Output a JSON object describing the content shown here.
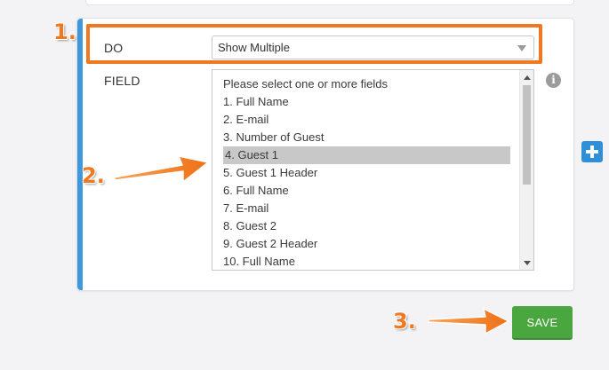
{
  "condition": {
    "do_label": "DO",
    "do_select_value": "Show Multiple",
    "field_label": "FIELD",
    "field_options": [
      "Please select one or more fields",
      "1. Full Name",
      "2. E-mail",
      "3. Number of Guest",
      "4. Guest 1",
      "5. Guest 1 Header",
      "6. Full Name",
      "7. E-mail",
      "8. Guest 2",
      "9. Guest 2 Header",
      "10. Full Name"
    ],
    "selected_option": "4. Guest 1"
  },
  "actions": {
    "save_label": "SAVE"
  },
  "annotations": {
    "step1": "1.",
    "step2": "2.",
    "step3": "3."
  },
  "colors": {
    "accent_orange": "#f07820",
    "card_accent_blue": "#3f98dc",
    "save_green": "#4aa63f",
    "plus_blue": "#2f8fd8",
    "selected_row_gray": "#c8c8c8"
  },
  "icons": {
    "info": "info-icon",
    "add": "plus-icon",
    "dropdown": "chevron-down-icon"
  }
}
